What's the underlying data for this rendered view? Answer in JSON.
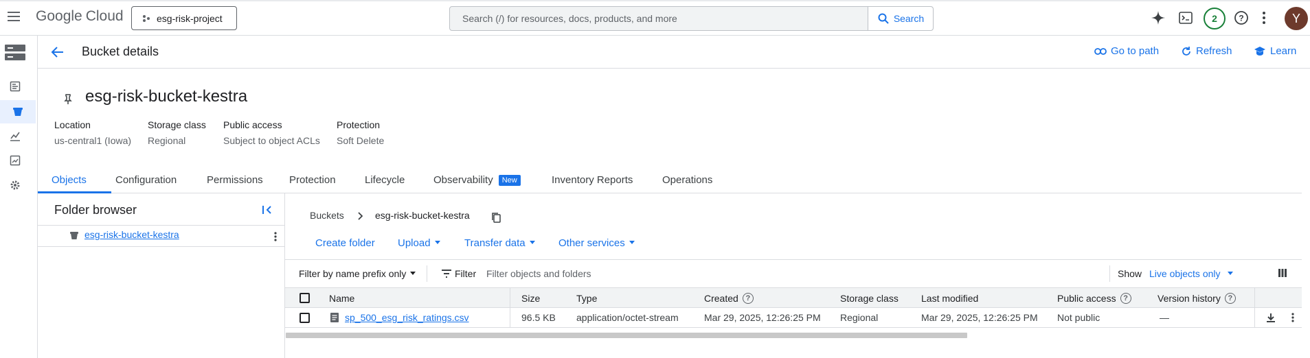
{
  "topbar": {
    "logo_google": "Google",
    "logo_cloud": "Cloud",
    "project_name": "esg-risk-project",
    "search_placeholder": "Search (/) for resources, docs, products, and more",
    "search_button": "Search",
    "notifications_count": "2",
    "avatar_initial": "Y"
  },
  "header": {
    "title": "Bucket details",
    "actions": {
      "go_to_path": "Go to path",
      "refresh": "Refresh",
      "learn": "Learn"
    }
  },
  "bucket": {
    "name": "esg-risk-bucket-kestra",
    "properties": [
      {
        "label": "Location",
        "value": "us-central1 (Iowa)"
      },
      {
        "label": "Storage class",
        "value": "Regional"
      },
      {
        "label": "Public access",
        "value": "Subject to object ACLs"
      },
      {
        "label": "Protection",
        "value": "Soft Delete"
      }
    ]
  },
  "tabs": [
    {
      "label": "Objects",
      "active": true
    },
    {
      "label": "Configuration"
    },
    {
      "label": "Permissions"
    },
    {
      "label": "Protection"
    },
    {
      "label": "Lifecycle"
    },
    {
      "label": "Observability",
      "badge": "New"
    },
    {
      "label": "Inventory Reports"
    },
    {
      "label": "Operations"
    }
  ],
  "folder_browser": {
    "title": "Folder browser",
    "root": "esg-risk-bucket-kestra"
  },
  "breadcrumb": {
    "root": "Buckets",
    "current": "esg-risk-bucket-kestra"
  },
  "object_actions": {
    "create_folder": "Create folder",
    "upload": "Upload",
    "transfer_data": "Transfer data",
    "other_services": "Other services"
  },
  "filter": {
    "prefix_mode": "Filter by name prefix only",
    "filter_label": "Filter",
    "placeholder": "Filter objects and folders",
    "show_label": "Show",
    "show_value": "Live objects only"
  },
  "table": {
    "columns": {
      "name": "Name",
      "size": "Size",
      "type": "Type",
      "created": "Created",
      "storage_class": "Storage class",
      "last_modified": "Last modified",
      "public_access": "Public access",
      "version_history": "Version history"
    },
    "rows": [
      {
        "name": "sp_500_esg_risk_ratings.csv",
        "size": "96.5 KB",
        "type": "application/octet-stream",
        "created": "Mar 29, 2025, 12:26:25 PM",
        "storage_class": "Regional",
        "last_modified": "Mar 29, 2025, 12:26:25 PM",
        "public_access": "Not public",
        "version_history": "—"
      }
    ]
  },
  "colors": {
    "accent": "#1a73e8",
    "avatar_bg": "#6d3a2c",
    "notif_green": "#188038"
  }
}
